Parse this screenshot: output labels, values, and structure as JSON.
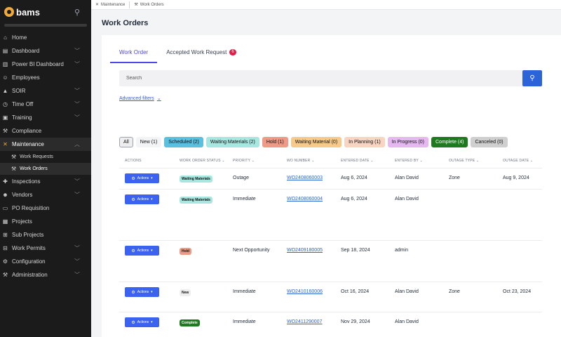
{
  "brand": {
    "name": "bams"
  },
  "sidebar": {
    "items": [
      {
        "label": "Home",
        "icon": "home-icon",
        "glyph": "⌂",
        "chevron": false
      },
      {
        "label": "Dashboard",
        "icon": "chart-icon",
        "glyph": "▤",
        "chevron": true
      },
      {
        "label": "Power BI Dashboard",
        "icon": "powerbi-icon",
        "glyph": "▥",
        "chevron": true
      },
      {
        "label": "Employees",
        "icon": "users-icon",
        "glyph": "☺",
        "chevron": false
      },
      {
        "label": "SOIR",
        "icon": "warning-icon",
        "glyph": "▲",
        "chevron": true
      },
      {
        "label": "Time Off",
        "icon": "clock-icon",
        "glyph": "◷",
        "chevron": true
      },
      {
        "label": "Training",
        "icon": "training-icon",
        "glyph": "▣",
        "chevron": true
      },
      {
        "label": "Compliance",
        "icon": "gavel-icon",
        "glyph": "⚒",
        "chevron": false
      },
      {
        "label": "Maintenance",
        "icon": "tools-icon",
        "glyph": "✕",
        "chevron": true,
        "active": true,
        "expanded": true
      },
      {
        "label": "Inspections",
        "icon": "inspection-icon",
        "glyph": "✚",
        "chevron": true
      },
      {
        "label": "Vendors",
        "icon": "vendor-icon",
        "glyph": "☻",
        "chevron": true
      },
      {
        "label": "PO Requisition",
        "icon": "cart-icon",
        "glyph": "▭",
        "chevron": false
      },
      {
        "label": "Projects",
        "icon": "projects-icon",
        "glyph": "▦",
        "chevron": false
      },
      {
        "label": "Sub Projects",
        "icon": "sitemap-icon",
        "glyph": "⊞",
        "chevron": false
      },
      {
        "label": "Work Permits",
        "icon": "permit-icon",
        "glyph": "⊟",
        "chevron": true
      },
      {
        "label": "Configuration",
        "icon": "gear-icon",
        "glyph": "⚙",
        "chevron": true
      },
      {
        "label": "Administration",
        "icon": "admin-icon",
        "glyph": "⚒",
        "chevron": true
      }
    ],
    "maintenance_sub": [
      {
        "label": "Work Requests",
        "selected": false
      },
      {
        "label": "Work Orders",
        "selected": true
      }
    ]
  },
  "breadcrumb": [
    {
      "label": "Maintenance",
      "icon": "tools-icon"
    },
    {
      "label": "Work Orders",
      "icon": "wrench-icon"
    }
  ],
  "page": {
    "title": "Work Orders"
  },
  "tabs": [
    {
      "label": "Work Order",
      "active": true
    },
    {
      "label": "Accepted Work Request",
      "badge": "6"
    }
  ],
  "search": {
    "placeholder": "Search"
  },
  "advanced_filters": {
    "label": "Advanced filters"
  },
  "filters": [
    {
      "label": "All",
      "bg": "#eeeeee",
      "border": "#9ca3af"
    },
    {
      "label": "New (1)",
      "bg": "#f3f4f6",
      "border": "#f3f4f6"
    },
    {
      "label": "Scheduled (2)",
      "bg": "#5bc0de",
      "border": "#5bc0de"
    },
    {
      "label": "Waiting Materials (2)",
      "bg": "#a8e6e0",
      "border": "#a8e6e0"
    },
    {
      "label": "Hold (1)",
      "bg": "#ef9a86",
      "border": "#ef9a86"
    },
    {
      "label": "Waiting Material (0)",
      "bg": "#f7c98a",
      "border": "#f7c98a"
    },
    {
      "label": "In Planning (1)",
      "bg": "#f8d4c2",
      "border": "#f8d4c2"
    },
    {
      "label": "In Progress (0)",
      "bg": "#e6b8f2",
      "border": "#e6b8f2"
    },
    {
      "label": "Complete (4)",
      "bg": "#1f7a1f",
      "border": "#1f7a1f",
      "fg": "#ffffff"
    },
    {
      "label": "Canceled (0)",
      "bg": "#cfcfcf",
      "border": "#cfcfcf"
    }
  ],
  "table": {
    "headers": [
      "ACTIONS",
      "WORK ORDER STATUS",
      "PRIORITY",
      "WO NUMBER",
      "ENTERED DATE",
      "ENTERED BY",
      "OUTAGE TYPE",
      "OUTAGE DATE"
    ],
    "action_label": "Actions",
    "rows": [
      {
        "status": "Waiting Materials",
        "status_bg": "#a8e6e0",
        "status_fg": "#111111",
        "priority": "Outage",
        "wo": "WO2408060003",
        "entered": "Aug 6, 2024",
        "by": "Alan David",
        "outage_type": "Zone",
        "outage_date": "Aug 9, 2024"
      },
      {
        "status": "Waiting Materials",
        "status_bg": "#a8e6e0",
        "status_fg": "#111111",
        "priority": "Immediate",
        "wo": "WO2408060004",
        "entered": "Aug 6, 2024",
        "by": "Alan David",
        "outage_type": "",
        "outage_date": ""
      },
      {
        "status": "Hold",
        "status_bg": "#ef9a86",
        "status_fg": "#111111",
        "priority": "Next Opportunity",
        "wo": "WO2409180005",
        "entered": "Sep 18, 2024",
        "by": "admin",
        "outage_type": "",
        "outage_date": ""
      },
      {
        "status": "New",
        "status_bg": "#eeeeee",
        "status_fg": "#111111",
        "priority": "Immediate",
        "wo": "WO2410160006",
        "entered": "Oct 16, 2024",
        "by": "Alan David",
        "outage_type": "Zone",
        "outage_date": "Oct 23, 2024"
      },
      {
        "status": "Complete",
        "status_bg": "#1f7a1f",
        "status_fg": "#ffffff",
        "priority": "Immediate",
        "wo": "WO2411290007",
        "entered": "Nov 29, 2024",
        "by": "Alan David",
        "outage_type": "",
        "outage_date": ""
      }
    ]
  }
}
